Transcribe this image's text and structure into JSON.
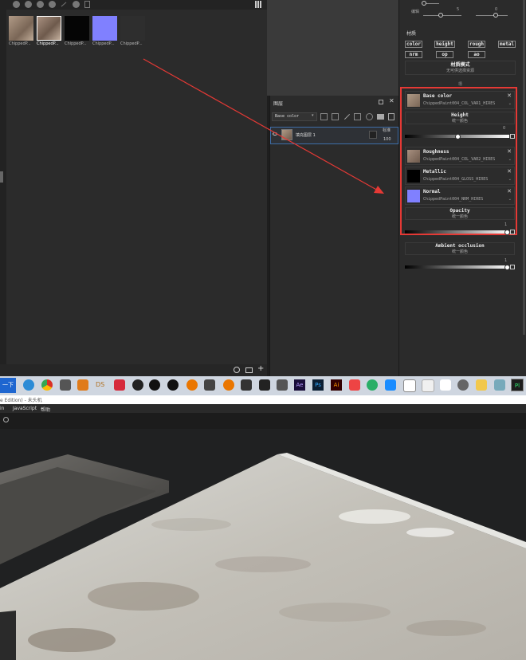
{
  "shelf": {
    "thumbnails": [
      {
        "label": "ChippedP...",
        "color": "#a08a78"
      },
      {
        "label": "ChippedP...",
        "color": "#9a8270",
        "selected": true
      },
      {
        "label": "ChippedP...",
        "color": "#050505"
      },
      {
        "label": "ChippedP...",
        "color": "#8080ff"
      },
      {
        "label": "ChippedP...",
        "color": "#2e2e2e"
      }
    ]
  },
  "top_sliders": {
    "label": "编辑",
    "val_left": "5",
    "val_right": "0"
  },
  "material": {
    "section_title": "材质",
    "chips": [
      "color",
      "height",
      "rough",
      "metal",
      "nrm",
      "op",
      "ao"
    ],
    "mode_title": "材质模式",
    "mode_sub": "无可供选择资源",
    "small_label": "槽"
  },
  "layers": {
    "title": "图层",
    "channel": "Base color",
    "layer_name": "填充图层 1",
    "blend": "标准",
    "opacity": "100"
  },
  "slots": [
    {
      "title": "Base color",
      "file": "ChippedPaint004_COL_VAR1_HIRES",
      "color": "#a08a78"
    },
    {
      "title": "Roughness",
      "file": "ChippedPaint004_COL_VAR2_HIRES",
      "color": "#a08a78"
    },
    {
      "title": "Metallic",
      "file": "ChippedPaint004_GLOSS_HIRES",
      "color": "#000000"
    },
    {
      "title": "Normal",
      "file": "ChippedPaint004_NRM_HIRES",
      "color": "#8080ff"
    }
  ],
  "uniform": {
    "height_title": "Height",
    "height_sub": "统一颜色",
    "height_val": "0",
    "opacity_title": "Opacity",
    "opacity_sub": "统一颜色",
    "opacity_val": "1",
    "ao_title": "Ambient occlusion",
    "ao_sub": "统一颜色",
    "ao_val": "1"
  },
  "taskbar": {
    "start_label": "一下",
    "ds_label": "DS",
    "ae_label": "Ae",
    "ps_label": "Ps",
    "ai_label": "Ai",
    "pl_label": "Pl"
  },
  "menubar": {
    "title": "e Edition) - 未头机",
    "menu1": "in",
    "menu2": "JavaScript",
    "menu3": "帮助"
  }
}
